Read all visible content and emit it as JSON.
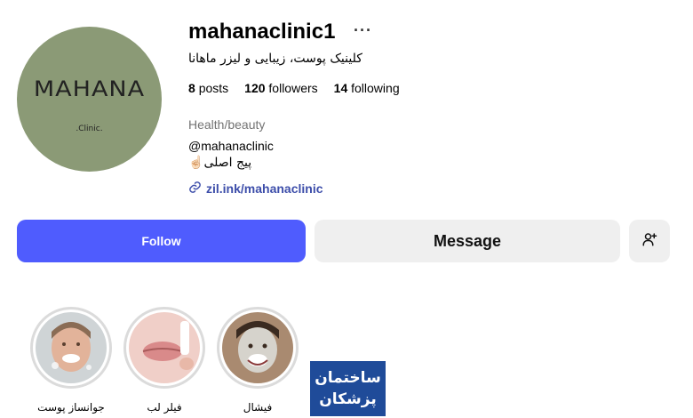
{
  "profile": {
    "username": "mahanaclinic1",
    "more_icon": "ellipsis-icon",
    "bio_title": "کلینیک پوست، زیبایی و لیزر ماهانا",
    "avatar": {
      "logo_text": "MAHANA",
      "sub_text": ".Clinic."
    }
  },
  "stats": {
    "posts_count": "8",
    "posts_label": "posts",
    "followers_count": "120",
    "followers_label": "followers",
    "following_count": "14",
    "following_label": "following"
  },
  "bio": {
    "category": "Health/beauty",
    "handle": "@mahanaclinic",
    "page_text": "پیج اصلی",
    "emoji": "☝🏻",
    "link": "zil.ink/mahanaclinic"
  },
  "actions": {
    "follow_label": "Follow",
    "message_label": "Message",
    "add_user_icon": "add-user-icon"
  },
  "highlights": [
    {
      "label": "جوانساز پوست"
    },
    {
      "label": "فیلر لب"
    },
    {
      "label": "فیشال"
    }
  ],
  "watermark": {
    "line1": "ساختمان",
    "line2": "پزشکان"
  },
  "colors": {
    "follow_bg": "#4f5cfe",
    "link": "#3d4eaa",
    "avatar_bg": "#8b9a76",
    "secondary_btn": "#efefef"
  }
}
